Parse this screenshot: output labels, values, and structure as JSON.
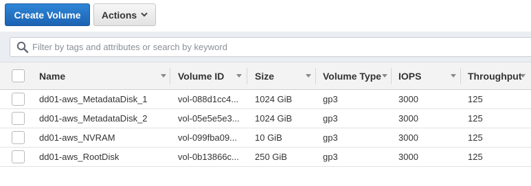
{
  "toolbar": {
    "create_label": "Create Volume",
    "actions_label": "Actions"
  },
  "search": {
    "placeholder": "Filter by tags and attributes or search by keyword",
    "value": ""
  },
  "table": {
    "columns": [
      "Name",
      "Volume ID",
      "Size",
      "Volume Type",
      "IOPS",
      "Throughput"
    ],
    "rows": [
      [
        "dd01-aws_MetadataDisk_1",
        "vol-088d1cc4...",
        "1024 GiB",
        "gp3",
        "3000",
        "125"
      ],
      [
        "dd01-aws_MetadataDisk_2",
        "vol-05e5e5e3...",
        "1024 GiB",
        "gp3",
        "3000",
        "125"
      ],
      [
        "dd01-aws_NVRAM",
        "vol-099fba09...",
        "10 GiB",
        "gp3",
        "3000",
        "125"
      ],
      [
        "dd01-aws_RootDisk",
        "vol-0b13866c...",
        "250 GiB",
        "gp3",
        "3000",
        "125"
      ]
    ]
  },
  "colors": {
    "primary": "#1b62b3",
    "filter_band": "#eaedf2",
    "header_bg": "#f3f3f3"
  },
  "icons": {
    "search": "search-icon",
    "actions_caret": "chevron-down-icon",
    "sort": "sort-caret-icon"
  }
}
